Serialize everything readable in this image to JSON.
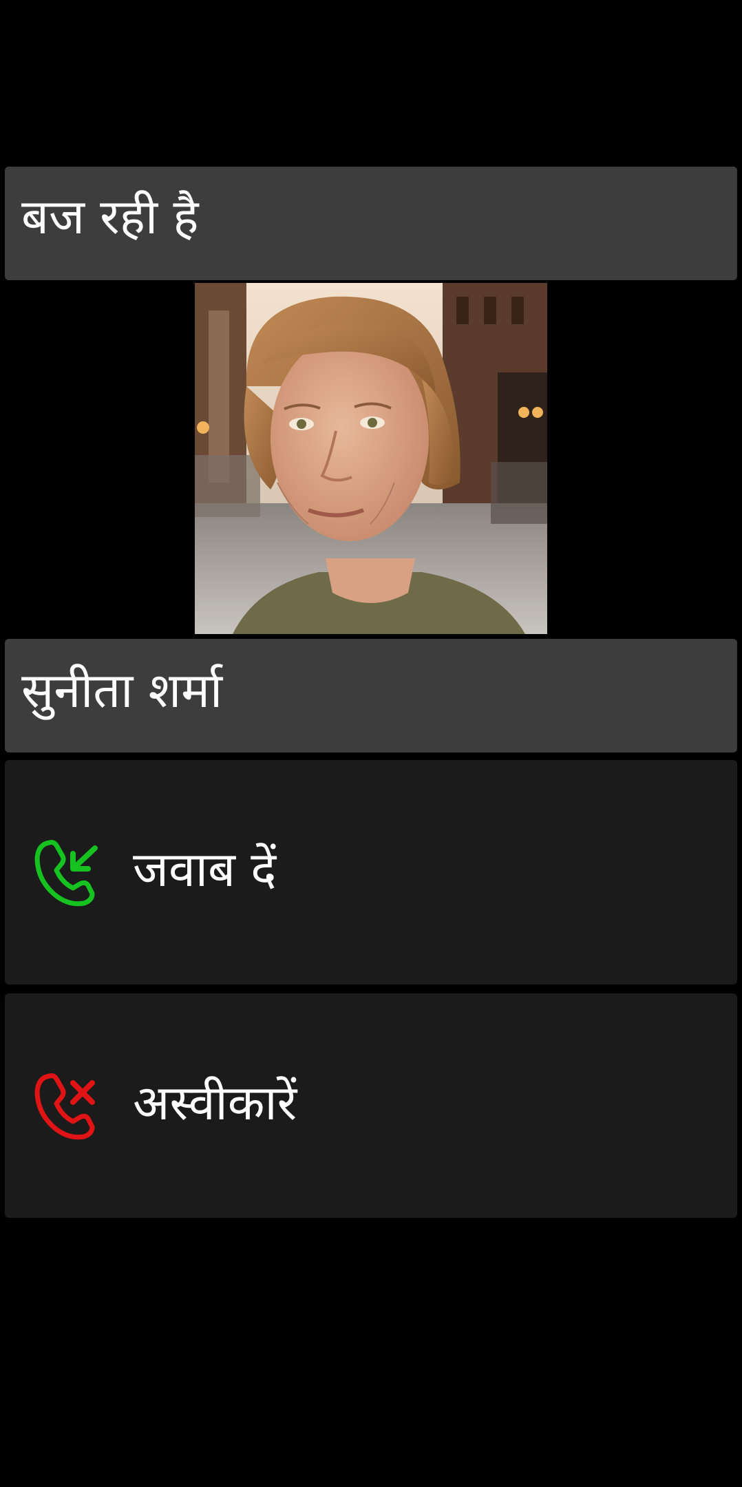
{
  "call": {
    "status": "बज रही है",
    "caller_name": "सुनीता शर्मा"
  },
  "actions": {
    "answer_label": "जवाब दें",
    "decline_label": "अस्वीकारें"
  },
  "icons": {
    "answer": "incoming-call-icon",
    "decline": "reject-call-icon"
  },
  "colors": {
    "background": "#000000",
    "panel": "#3d3d3d",
    "button": "#1b1b1b",
    "answer_green": "#16c21f",
    "decline_red": "#e01414"
  }
}
